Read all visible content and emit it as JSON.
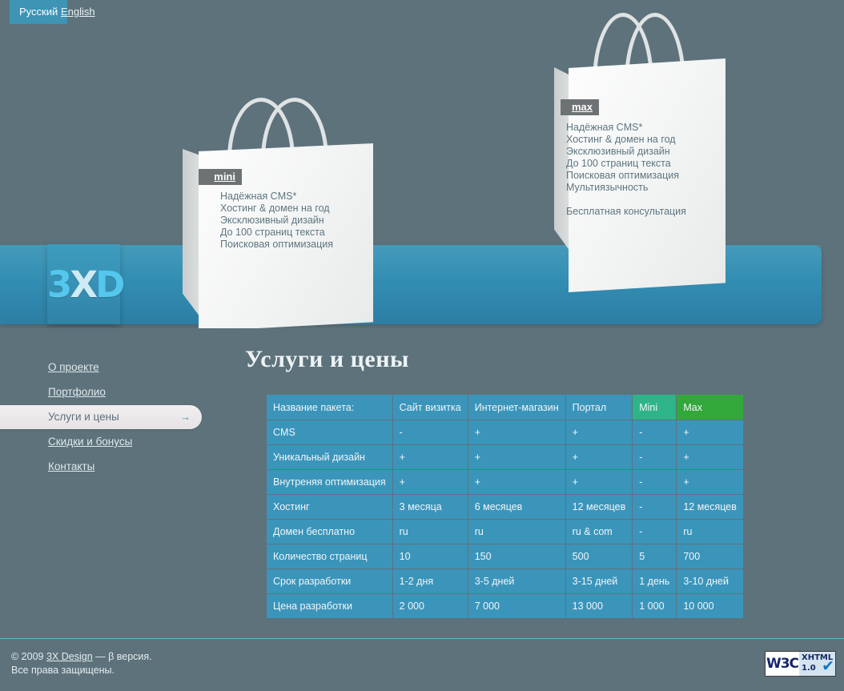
{
  "languages": [
    {
      "label": "Русский",
      "active": true
    },
    {
      "label": "English",
      "active": false
    }
  ],
  "brand": {
    "logo_text_left": "3",
    "logo_text_x": "X",
    "logo_text_right": "D"
  },
  "hero": {
    "bags": [
      {
        "label": "mini",
        "items": [
          "Надёжная CMS*",
          "Хостинг & домен на год",
          "Эксклюзивный дизайн",
          "До 100 страниц текста",
          "Поисковая оптимизация"
        ]
      },
      {
        "label": "max",
        "items": [
          "Надёжная CMS*",
          "Хостинг & домен на год",
          "Эксклюзивный дизайн",
          "До 100 страниц текста",
          "Поисковая оптимизация",
          "Мультиязычность"
        ],
        "extra": "Бесплатная консультация"
      }
    ]
  },
  "nav": {
    "items": [
      {
        "label": "О проекте",
        "active": false
      },
      {
        "label": "Портфолио",
        "active": false
      },
      {
        "label": "Услуги и цены",
        "active": true,
        "arrow": "→"
      },
      {
        "label": "Скидки и бонусы",
        "active": false
      },
      {
        "label": "Контакты",
        "active": false
      }
    ]
  },
  "main": {
    "title": "Услуги и цены"
  },
  "table": {
    "headers": [
      "Название пакета:",
      "Сайт визитка",
      "Интернет-магазин",
      "Портал",
      "Mini",
      "Max"
    ],
    "rows": [
      [
        "CMS",
        "-",
        "+",
        "+",
        "-",
        "+"
      ],
      [
        "Уникальный дизайн",
        "+",
        "+",
        "+",
        "-",
        "+"
      ],
      [
        "Внутреняя оптимизация",
        "+",
        "+",
        "+",
        "-",
        "+"
      ],
      [
        "Хостинг",
        "3 месяца",
        "6 месяцев",
        "12 месяцев",
        "-",
        "12 месяцев"
      ],
      [
        "Домен бесплатно",
        "ru",
        "ru",
        "ru & com",
        "-",
        "ru"
      ],
      [
        "Количество страниц",
        "10",
        "150",
        "500",
        "5",
        "700"
      ],
      [
        "Срок разработки",
        "1-2 дня",
        "3-5 дней",
        "3-15 дней",
        "1 день",
        "3-10 дней"
      ],
      [
        "Цена разработки",
        "2 000",
        "7 000",
        "13 000",
        "1 000",
        "10 000"
      ]
    ]
  },
  "footer": {
    "copyright_prefix": "© 2009 ",
    "company": "3X Design",
    "copyright_suffix": " — β версия.",
    "rights": "Все права защищены."
  },
  "badge": {
    "left": "W3C",
    "line1": "XHTML",
    "line2": "1.0",
    "check": "✔"
  },
  "colors": {
    "page_bg": "#5d727b",
    "band_blue": "#3490b4",
    "table_cell": "#3b95bb",
    "mini_green": "#2eb489",
    "max_green": "#33a83a",
    "accent_link": "#5fb4d4"
  }
}
